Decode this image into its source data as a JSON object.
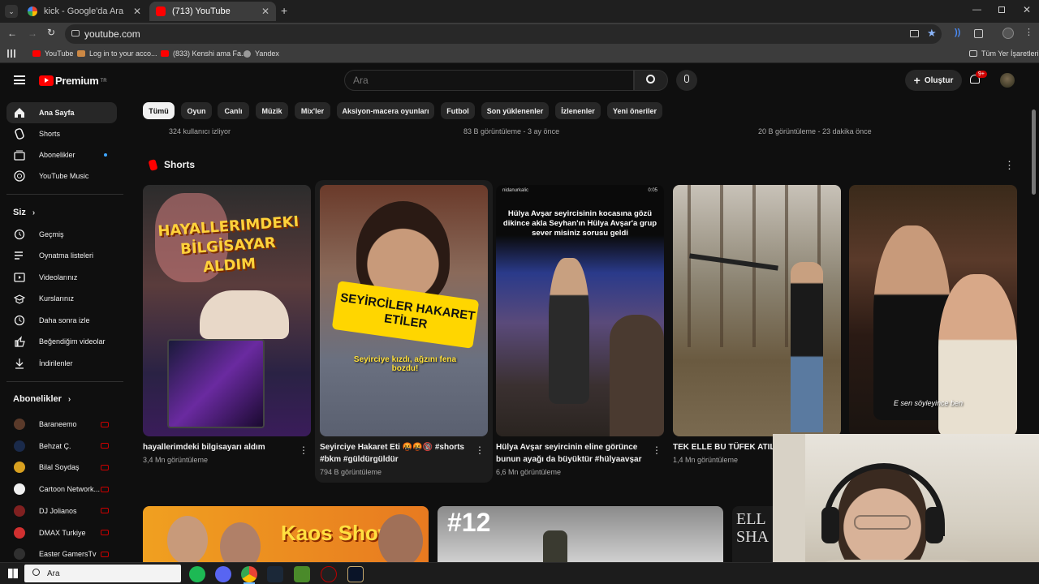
{
  "browser": {
    "tabs": [
      {
        "title": "kick - Google'da Ara",
        "active": false
      },
      {
        "title": "(713) YouTube",
        "active": true
      }
    ],
    "new_tab": "+",
    "url": "youtube.com",
    "bookmarks": [
      "YouTube",
      "Log in to your acco...",
      "(833) Kenshi ama Fa...",
      "Yandex"
    ],
    "all_bookmarks": "Tüm Yer İşaretleri"
  },
  "youtube": {
    "logo": "Premium",
    "logo_sup": "TR",
    "search_placeholder": "Ara",
    "create_label": "Oluştur",
    "notifications_badge": "9+"
  },
  "sidebar": {
    "main": [
      {
        "label": "Ana Sayfa",
        "icon": "home-icon",
        "active": true
      },
      {
        "label": "Shorts",
        "icon": "shorts-icon"
      },
      {
        "label": "Abonelikler",
        "icon": "subscriptions-icon",
        "dot": true
      },
      {
        "label": "YouTube Music",
        "icon": "music-icon"
      }
    ],
    "you_header": "Siz",
    "you": [
      {
        "label": "Geçmiş",
        "icon": "history-icon"
      },
      {
        "label": "Oynatma listeleri",
        "icon": "playlists-icon"
      },
      {
        "label": "Videolarınız",
        "icon": "your-videos-icon"
      },
      {
        "label": "Kurslarınız",
        "icon": "courses-icon"
      },
      {
        "label": "Daha sonra izle",
        "icon": "watch-later-icon"
      },
      {
        "label": "Beğendiğim videolar",
        "icon": "like-icon"
      },
      {
        "label": "İndirilenler",
        "icon": "download-icon"
      }
    ],
    "subs_header": "Abonelikler",
    "subscriptions": [
      {
        "label": "Baraneemo",
        "color": "#5a3a2a"
      },
      {
        "label": "Behzat Ç.",
        "color": "#1a2a4a"
      },
      {
        "label": "Bilal Soydaş",
        "color": "#d8a020"
      },
      {
        "label": "Cartoon Network...",
        "color": "#f0f0f0"
      },
      {
        "label": "DJ Jolianos",
        "color": "#802020"
      },
      {
        "label": "DMAX Turkiye",
        "color": "#d03030"
      },
      {
        "label": "Easter GamersTv",
        "color": "#303030"
      }
    ]
  },
  "chips": [
    "Tümü",
    "Oyun",
    "Canlı",
    "Müzik",
    "Mix'ler",
    "Aksiyon-macera oyunları",
    "Futbol",
    "Son yüklenenler",
    "İzlenenler",
    "Yeni öneriler"
  ],
  "top_meta": [
    "324 kullanıcı izliyor",
    "83 B görüntüleme - 3 ay önce",
    "20 B görüntüleme - 23 dakika önce"
  ],
  "shorts": {
    "title": "Shorts",
    "items": [
      {
        "title": "hayallerimdeki bilgisayarı aldım",
        "views": "3,4 Mn görüntüleme",
        "overlay": "HAYALLERIMDEKI BİLGİSAYAR ALDIM"
      },
      {
        "title": "Seyirciye Hakaret Eti 🤬🤬🔞 #shorts #bkm #güldürgüldür",
        "views": "794 B görüntüleme",
        "overlay": "SEYİRCİLER HAKARET ETİLER",
        "overlay2": "Seyirciye kızdı, ağzını fena bozdu!"
      },
      {
        "title": "Hülya Avşar seyircinin eline görünce bunun ayağı da büyüktür #hülyaavşar",
        "views": "6,6 Mn görüntüleme",
        "overlay": "Hülya Avşar seyircisinin kocasına gözü dikince akla Seyhan'ın Hülya Avşar'a grup sever misiniz sorusu geldi",
        "handle": "nidanurkalic",
        "duration": "0:05"
      },
      {
        "title": "TEK ELLE BU TÜFEK ATILI",
        "views": "1,4 Mn görüntüleme"
      },
      {
        "title": "",
        "views": "",
        "overlay": "E sen söyleyince ben"
      }
    ]
  },
  "bottom_thumbs": [
    "Kaos Show",
    "#12",
    "ELL SHA"
  ],
  "taskbar": {
    "search_placeholder": "Ara"
  }
}
